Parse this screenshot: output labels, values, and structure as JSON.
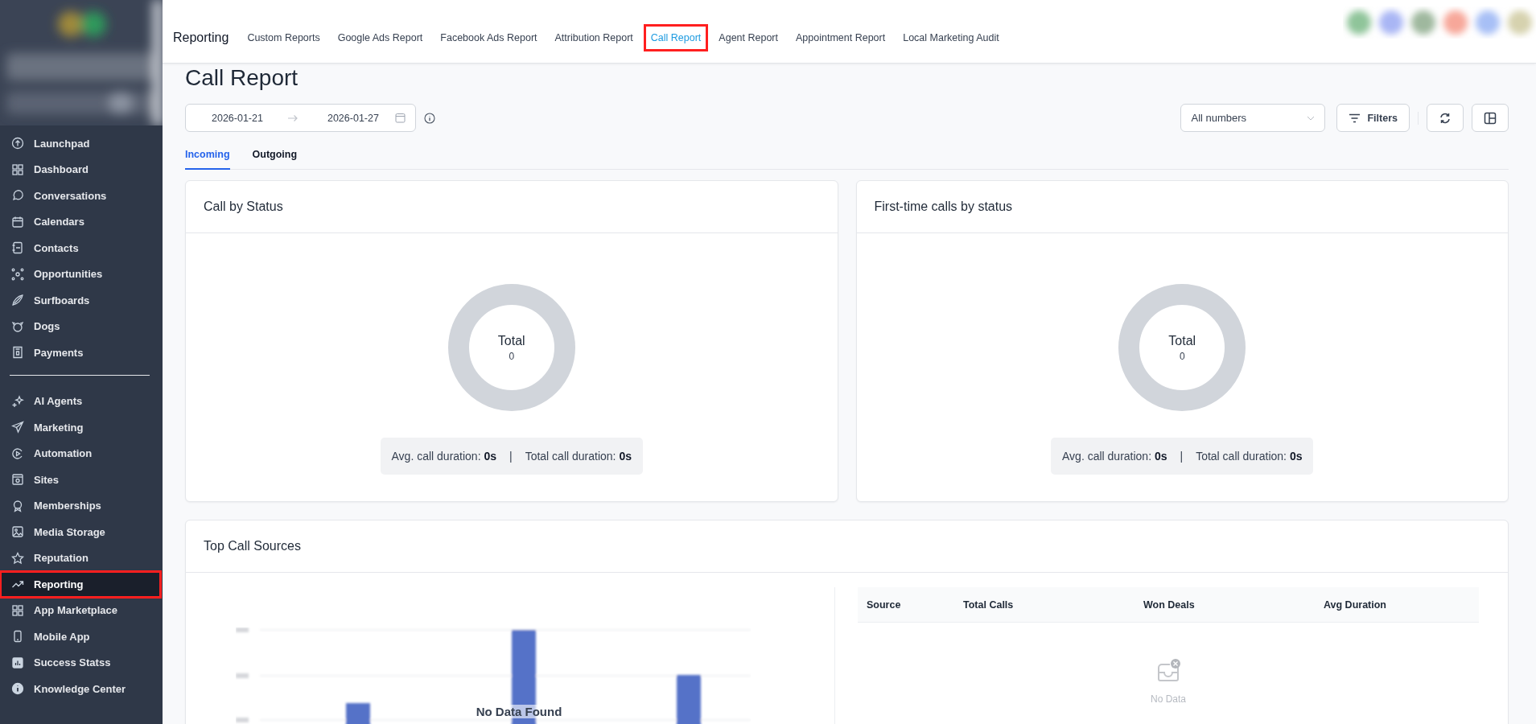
{
  "sidebar": {
    "groups": [
      {
        "items": [
          {
            "label": "Launchpad",
            "selected": false,
            "highlighted": false
          },
          {
            "label": "Dashboard",
            "selected": false,
            "highlighted": false
          },
          {
            "label": "Conversations",
            "selected": false,
            "highlighted": false
          },
          {
            "label": "Calendars",
            "selected": false,
            "highlighted": false
          },
          {
            "label": "Contacts",
            "selected": false,
            "highlighted": false
          },
          {
            "label": "Opportunities",
            "selected": false,
            "highlighted": false
          },
          {
            "label": "Surfboards",
            "selected": false,
            "highlighted": false
          },
          {
            "label": "Dogs",
            "selected": false,
            "highlighted": false
          },
          {
            "label": "Payments",
            "selected": false,
            "highlighted": false
          }
        ]
      },
      {
        "items": [
          {
            "label": "AI Agents",
            "selected": false,
            "highlighted": false
          },
          {
            "label": "Marketing",
            "selected": false,
            "highlighted": false
          },
          {
            "label": "Automation",
            "selected": false,
            "highlighted": false
          },
          {
            "label": "Sites",
            "selected": false,
            "highlighted": false
          },
          {
            "label": "Memberships",
            "selected": false,
            "highlighted": false
          },
          {
            "label": "Media Storage",
            "selected": false,
            "highlighted": false
          },
          {
            "label": "Reputation",
            "selected": false,
            "highlighted": false
          },
          {
            "label": "Reporting",
            "selected": true,
            "highlighted": true
          },
          {
            "label": "App Marketplace",
            "selected": false,
            "highlighted": false
          },
          {
            "label": "Mobile App",
            "selected": false,
            "highlighted": false
          },
          {
            "label": "Success Statss",
            "selected": false,
            "highlighted": false
          },
          {
            "label": "Knowledge Center",
            "selected": false,
            "highlighted": false
          }
        ]
      }
    ]
  },
  "top_nav": {
    "title": "Reporting",
    "tabs": [
      {
        "label": "Custom Reports",
        "selected": false,
        "highlighted": false
      },
      {
        "label": "Google Ads Report",
        "selected": false,
        "highlighted": false
      },
      {
        "label": "Facebook Ads Report",
        "selected": false,
        "highlighted": false
      },
      {
        "label": "Attribution Report",
        "selected": false,
        "highlighted": false
      },
      {
        "label": "Call Report",
        "selected": true,
        "highlighted": true
      },
      {
        "label": "Agent Report",
        "selected": false,
        "highlighted": false
      },
      {
        "label": "Appointment Report",
        "selected": false,
        "highlighted": false
      },
      {
        "label": "Local Marketing Audit",
        "selected": false,
        "highlighted": false
      }
    ]
  },
  "page_title": "Call Report",
  "date_range": {
    "start": "2026-01-21",
    "end": "2026-01-27"
  },
  "number_select": {
    "value": "All numbers"
  },
  "filters_button": "Filters",
  "direction_tabs": [
    {
      "label": "Incoming",
      "selected": true
    },
    {
      "label": "Outgoing",
      "selected": false
    }
  ],
  "status_cards": [
    {
      "title": "Call by Status",
      "center_label": "Total",
      "center_value": "0",
      "avg_label": "Avg. call duration: ",
      "avg_value": "0s",
      "separator": "|",
      "total_label": "Total call duration: ",
      "total_value": "0s"
    },
    {
      "title": "First-time calls by status",
      "center_label": "Total",
      "center_value": "0",
      "avg_label": "Avg. call duration: ",
      "avg_value": "0s",
      "separator": "|",
      "total_label": "Total call duration: ",
      "total_value": "0s"
    }
  ],
  "sources_card": {
    "title": "Top Call Sources",
    "chart_message": "No Data Found",
    "table": {
      "columns": [
        "Source",
        "Total Calls",
        "Won Deals",
        "Avg Duration"
      ],
      "empty_text": "No Data"
    }
  }
}
